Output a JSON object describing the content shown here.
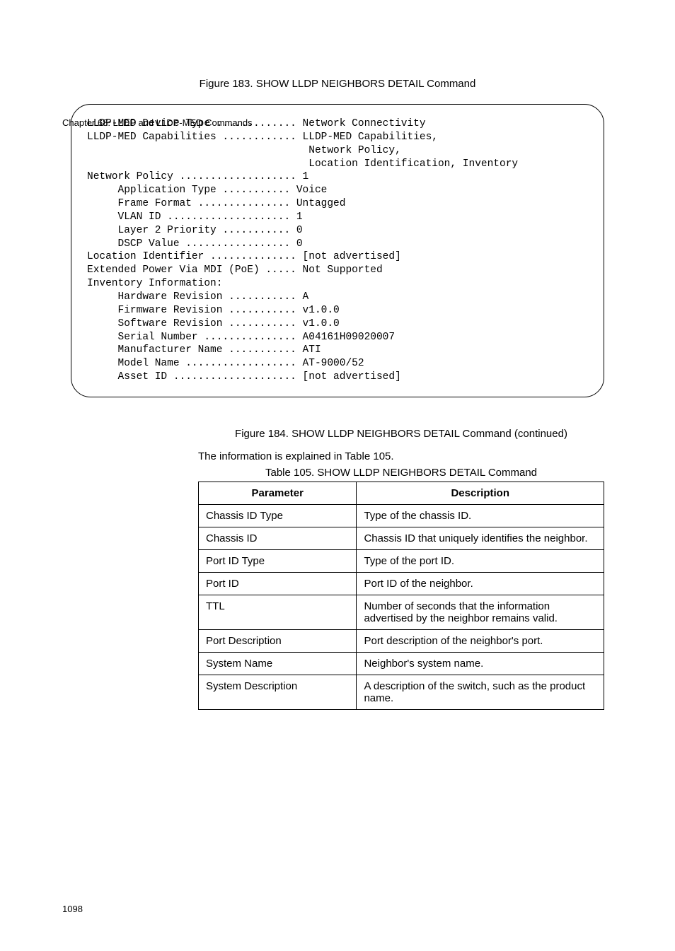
{
  "header": {
    "chapter": "Chapter 68: LLDP and LLDP-MED Commands"
  },
  "figure_top_caption": "Figure 183. SHOW LLDP NEIGHBORS DETAIL Command",
  "code": {
    "lines": [
      "LLDP-MED Device Type ............. Network Connectivity",
      "LLDP-MED Capabilities ............ LLDP-MED Capabilities,",
      "                                    Network Policy,",
      "                                    Location Identification, Inventory",
      "Network Policy ................... 1",
      "     Application Type ........... Voice",
      "     Frame Format ............... Untagged",
      "     VLAN ID .................... 1",
      "     Layer 2 Priority ........... 0",
      "     DSCP Value ................. 0",
      "Location Identifier .............. [not advertised]",
      "Extended Power Via MDI (PoE) ..... Not Supported",
      "Inventory Information:",
      "     Hardware Revision ........... A",
      "     Firmware Revision ........... v1.0.0",
      "     Software Revision ........... v1.0.0",
      "     Serial Number ............... A04161H09020007",
      "     Manufacturer Name ........... ATI",
      "     Model Name .................. AT-9000/52",
      "     Asset ID .................... [not advertised]"
    ]
  },
  "figure_bottom_caption": "Figure 184. SHOW LLDP NEIGHBORS DETAIL Command (continued)",
  "intro_text": "The information is explained in Table 105.",
  "table_caption": "Table 105. SHOW LLDP NEIGHBORS DETAIL Command",
  "table": {
    "headers": [
      "Parameter",
      "Description"
    ],
    "rows": [
      [
        "Chassis ID Type",
        "Type of the chassis ID."
      ],
      [
        "Chassis ID",
        "Chassis ID that uniquely identifies the neighbor."
      ],
      [
        "Port ID Type",
        "Type of the port ID."
      ],
      [
        "Port ID",
        "Port ID of the neighbor."
      ],
      [
        "TTL",
        "Number of seconds that the information advertised by the neighbor remains valid."
      ],
      [
        "Port Description",
        "Port description of the neighbor's port."
      ],
      [
        "System Name",
        "Neighbor's system name."
      ],
      [
        "System Description",
        "A description of the switch, such as the product name."
      ]
    ]
  },
  "page_number": "1098"
}
